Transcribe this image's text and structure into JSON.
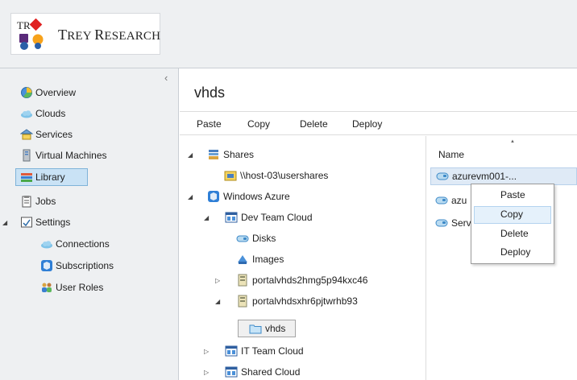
{
  "brand": {
    "logo_mark_text": "TR",
    "logo_text_first": "T",
    "logo_text_rest": "REY RESEARCH",
    "logo_text_second_cap": "R",
    "logo_text_second_rest": "ESEARCH"
  },
  "nav": {
    "collapse_glyph": "‹",
    "items": [
      {
        "label": "Overview",
        "icon": "overview-icon"
      },
      {
        "label": "Clouds",
        "icon": "cloud-icon"
      },
      {
        "label": "Services",
        "icon": "services-icon"
      },
      {
        "label": "Virtual Machines",
        "icon": "virtual-machine-icon"
      },
      {
        "label": "Library",
        "icon": "library-icon",
        "selected": true
      },
      {
        "label": "Jobs",
        "icon": "jobs-icon"
      },
      {
        "label": "Settings",
        "icon": "settings-icon"
      },
      {
        "label": "Connections",
        "icon": "connections-icon"
      },
      {
        "label": "Subscriptions",
        "icon": "subscriptions-icon"
      },
      {
        "label": "User Roles",
        "icon": "user-roles-icon"
      }
    ],
    "expander_glyph": "◢"
  },
  "main": {
    "title": "vhds",
    "toolbar": [
      "Paste",
      "Copy",
      "Delete",
      "Deploy"
    ],
    "tree": [
      {
        "label": "Shares"
      },
      {
        "label": "\\\\host-03\\usershares"
      },
      {
        "label": "Windows Azure"
      },
      {
        "label": "Dev Team Cloud"
      },
      {
        "label": "Disks"
      },
      {
        "label": "Images"
      },
      {
        "label": "portalvhds2hmg5p94kxc46"
      },
      {
        "label": "portalvhdsxhr6pjtwrhb93"
      },
      {
        "label": "vhds",
        "selected": true
      },
      {
        "label": "IT Team Cloud"
      },
      {
        "label": "Shared Cloud"
      }
    ],
    "list": {
      "column_name": "Name",
      "sort_glyph": "▲",
      "rows": [
        {
          "label": "azurevm001-...",
          "selected": true
        },
        {
          "label": "azu"
        },
        {
          "label": "Serv"
        }
      ]
    }
  },
  "context_menu": {
    "items": [
      {
        "label": "Paste"
      },
      {
        "label": "Copy",
        "hover": true
      },
      {
        "label": "Delete"
      },
      {
        "label": "Deploy"
      }
    ]
  },
  "colors": {
    "chrome_bg": "#eef0f2",
    "selection_bg": "#c9e2f5",
    "selection_border": "#7fb3d9",
    "brand_red": "#e02020",
    "brand_blue": "#2a5fa8",
    "brand_purple": "#5a2a7a",
    "brand_orange": "#f7a21b"
  }
}
